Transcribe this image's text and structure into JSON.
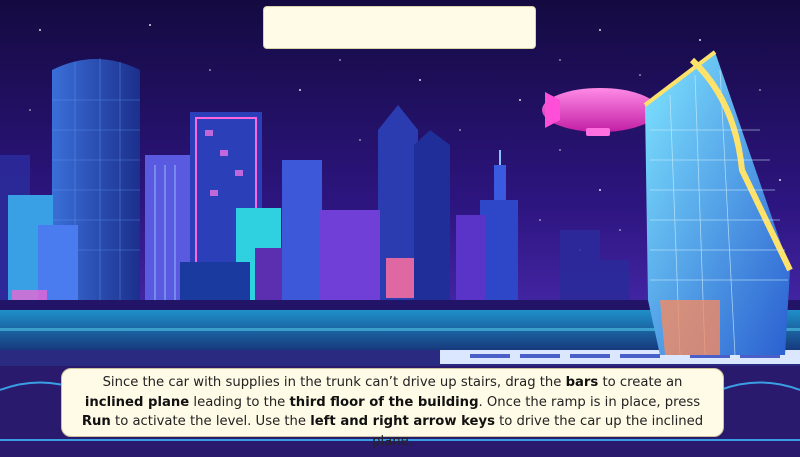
{
  "title_box": {
    "text": ""
  },
  "instructions": {
    "t1": "Since the car with supplies in the trunk can’t drive up stairs, drag the ",
    "b1": "bars",
    "t2": " to create an ",
    "b2": "inclined plane",
    "t3": " leading to the ",
    "b3": "third floor of the building",
    "t4": ". Once the ramp is in place, press ",
    "b4": "Run",
    "t5": " to activate the level. Use the ",
    "b5": "left and right arrow keys",
    "t6": " to drive the car up the inclined plane."
  },
  "colors": {
    "sky_top": "#150a45",
    "sky_mid": "#3a1a8a",
    "neon_pink": "#ff4fd8",
    "neon_cyan": "#3fe0ff",
    "panel": "#fffbe6"
  }
}
